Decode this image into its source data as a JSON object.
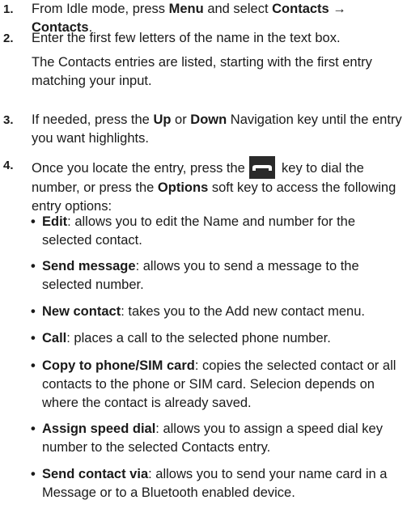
{
  "steps": [
    {
      "num": "1.",
      "pre": "From Idle mode, press ",
      "b1": "Menu",
      "mid": " and select ",
      "b2": "Contacts",
      "arrow": " → ",
      "b3": "Contacts",
      "post": "."
    },
    {
      "num": "2.",
      "line1": "Enter the first few letters of the name in the text box.",
      "line2": "The Contacts entries are listed, starting with the first entry matching your input."
    },
    {
      "num": "3.",
      "pre": "If needed, press the ",
      "b1": "Up",
      "mid": " or ",
      "b2": "Down",
      "post": " Navigation key until the entry you want highlights."
    },
    {
      "num": "4.",
      "pre": "Once you locate the entry, press the ",
      "icon": "send-call-key-icon",
      "mid": " key to dial the number, or press the ",
      "b1": "Options",
      "post": " soft key to access the following entry options:"
    }
  ],
  "options": [
    {
      "term": "Edit",
      "desc": ": allows you to edit the Name and number for the selected contact."
    },
    {
      "term": "Send message",
      "desc": ": allows you to send a message to the selected number."
    },
    {
      "term": "New contact",
      "desc": ": takes you to the Add new contact menu."
    },
    {
      "term": "Call",
      "desc": ": places a call to the selected phone number."
    },
    {
      "term": "Copy to phone/SIM card",
      "desc": ": copies the selected contact or all contacts to the phone or SIM card. Selecion depends on where the contact is already saved."
    },
    {
      "term": "Assign speed dial",
      "desc": ": allows you to assign a speed dial key number to the selected Contacts entry."
    },
    {
      "term": "Send contact via",
      "desc": ": allows you to send your name card in a Message or to a Bluetooth enabled device."
    }
  ],
  "bullet_char": "•"
}
